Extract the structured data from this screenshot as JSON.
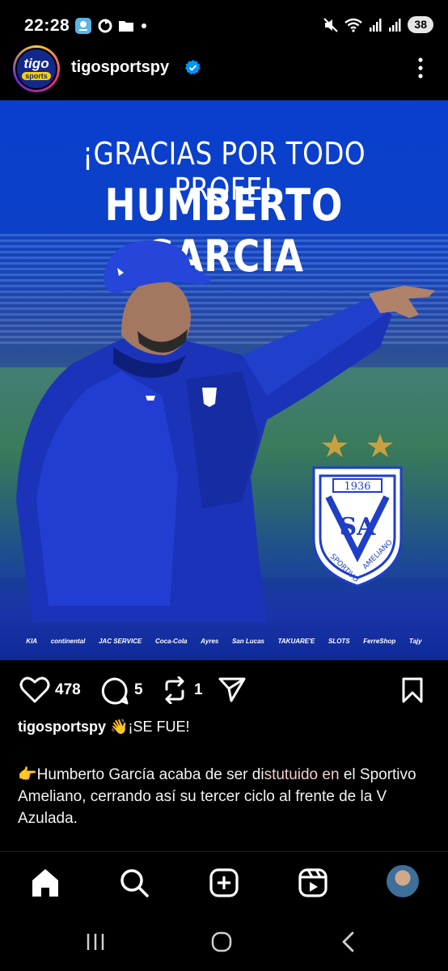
{
  "status_bar": {
    "time": "22:28",
    "battery": "38",
    "icons_left": [
      "location-app-icon",
      "sync-icon",
      "folder-icon",
      "dot-icon"
    ],
    "icons_right": [
      "mute-icon",
      "wifi-icon",
      "signal-icon",
      "signal-icon"
    ]
  },
  "post": {
    "username": "tigosportspy",
    "verified": true,
    "avatar_text": "tigo",
    "avatar_subtext": "sports",
    "image": {
      "headline_line1": "¡GRACIAS POR TODO PROFE!",
      "headline_line2": "HUMBERTO GARCIA",
      "crest_year": "1936",
      "crest_letters": "SA",
      "crest_text_left": "SPORTIVO",
      "crest_text_right": "AMELIANO",
      "sponsors": [
        "KIA",
        "continental",
        "JAC SERVICE",
        "Coca-Cola",
        "Ayres",
        "San Lucas",
        "TAKUARE'E",
        "SLOTS",
        "FerreShop",
        "Tajy"
      ]
    },
    "actions": {
      "likes": "478",
      "comments": "5",
      "reposts": "1"
    },
    "caption": {
      "user": "tigosportspy",
      "first_line": "👋¡SE FUE!",
      "body_pre": "👉Humberto García acaba de ser di",
      "body_hl1": "stutuido",
      "body_mid": " en",
      "body_rest": " el Sportivo Ameliano, cerrando así su tercer ciclo al frente de la V Azulada."
    }
  },
  "colors": {
    "accent_blue": "#1d4fe0",
    "verified_blue": "#0095f6",
    "background": "#000000",
    "gold_star": "#c9a040"
  },
  "bottom_nav": [
    "home-icon",
    "search-icon",
    "create-icon",
    "reels-icon",
    "profile-avatar"
  ]
}
